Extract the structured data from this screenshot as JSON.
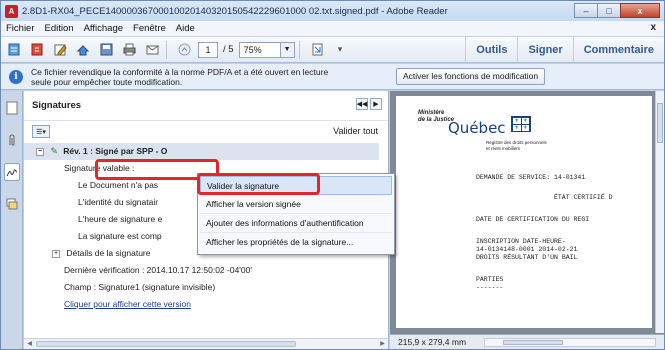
{
  "window": {
    "title": "2.8D1-RX04_PECE14000036700010020140320150542229601000 02.txt.signed.pdf - Adobe Reader",
    "app_icon_letter": "A",
    "controls": {
      "minimize": "–",
      "maximize": "□",
      "close": "x"
    }
  },
  "menubar": {
    "items": [
      "Fichier",
      "Edition",
      "Affichage",
      "Fenêtre",
      "Aide"
    ],
    "close_glyph": "x"
  },
  "toolbar": {
    "page_number": "1",
    "page_total": "/ 5",
    "zoom": "75%",
    "tools_label": "Outils",
    "sign_label": "Signer",
    "comment_label": "Commentaire"
  },
  "infobar": {
    "icon": "i",
    "message": "Ce fichier revendique la conformité à la norme PDF/A et a été ouvert en lecture seule pour empêcher toute modification.",
    "button": "Activer les fonctions de modification"
  },
  "panel": {
    "title": "Signatures",
    "validate_all": "Valider tout",
    "tree": [
      {
        "text": "Rév. 1 : Signé par SPP - O",
        "level": 0,
        "selected": true,
        "expander": "−"
      },
      {
        "text": "Signature valable :",
        "level": 1
      },
      {
        "text": "Le Document n'a pas",
        "level": 2
      },
      {
        "text": "L'identité du signatair",
        "level": 2
      },
      {
        "text": "L'heure de signature e",
        "level": 2
      },
      {
        "text": "La signature est comp",
        "level": 2
      },
      {
        "text": "Détails de la signature",
        "level": 1,
        "expander": "+"
      },
      {
        "text": "Dernière vérification : 2014.10.17 12:50:02 -04'00'",
        "level": 1
      },
      {
        "text": "Champ : Signature1 (signature invisible)",
        "level": 1
      },
      {
        "text": "Cliquer pour afficher cette version",
        "level": 1,
        "link": true
      }
    ]
  },
  "context_menu": {
    "items": [
      "Valider la signature",
      "Afficher la version signée",
      "Ajouter des informations d'authentification",
      "Afficher les propriétés de la signature..."
    ]
  },
  "document": {
    "ministere": "Ministère\nde la Justice",
    "brand": "Québec",
    "registre": "Registre des droits personnels\net réels mobiliers",
    "lines": [
      "DEMANDE DE SERVICE:  14-01341",
      "ÉTAT CERTIFIÉ D",
      "DATE DE CERTIFICATION DU REGI",
      "INSCRIPTION       DATE-HEURE-",
      "14-0134148-0001   2014-02-21",
      "DROITS RÉSULTANT D'UN BAIL",
      "PARTIES",
      "-------"
    ],
    "page_size": "215,9 x 279,4 mm"
  }
}
